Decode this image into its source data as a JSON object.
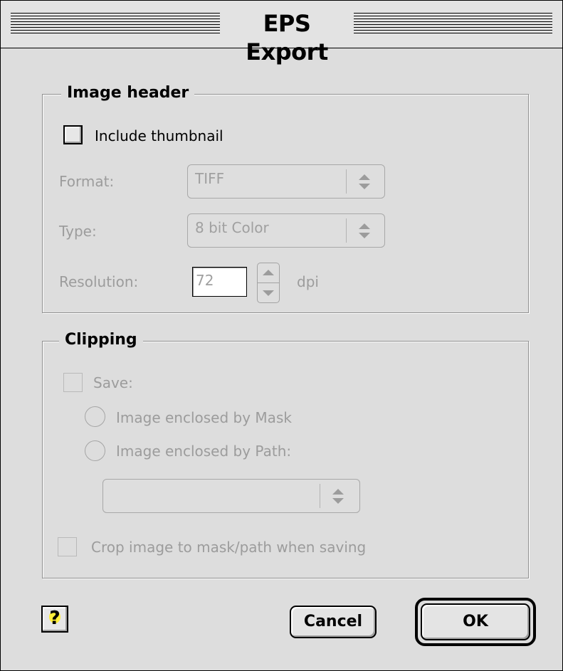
{
  "window": {
    "title": "EPS Export"
  },
  "image_header": {
    "group_title": "Image header",
    "include_thumbnail_label": "Include thumbnail",
    "format_label": "Format:",
    "format_value": "TIFF",
    "type_label": "Type:",
    "type_value": "8 bit Color",
    "resolution_label": "Resolution:",
    "resolution_value": "72",
    "resolution_unit": "dpi"
  },
  "clipping": {
    "group_title": "Clipping",
    "save_label": "Save:",
    "mask_option_label": "Image enclosed by Mask",
    "path_option_label": "Image enclosed by Path:",
    "path_popup_value": "",
    "crop_label": "Crop image to  mask/path when saving"
  },
  "buttons": {
    "cancel": "Cancel",
    "ok": "OK"
  },
  "icons": {
    "help": "help-question-icon",
    "popup_arrows": "up-down-arrows-icon"
  }
}
